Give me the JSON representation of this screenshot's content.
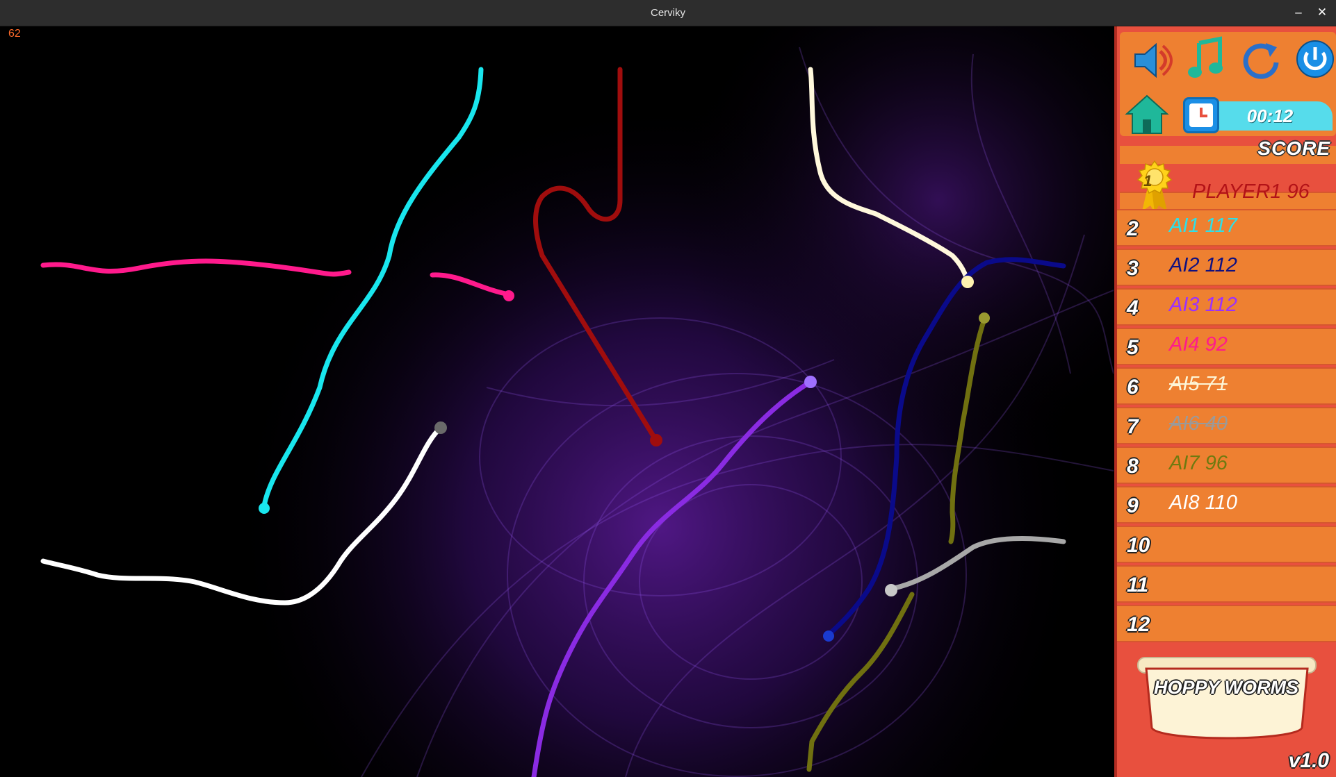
{
  "window": {
    "title": "Cerviky",
    "minimize_glyph": "–",
    "close_glyph": "✕"
  },
  "fps": "62",
  "toolbar": {
    "sound_icon": "speaker-icon",
    "music_icon": "music-note-icon",
    "restart_icon": "restart-icon",
    "power_icon": "power-icon",
    "home_icon": "home-icon",
    "clock_icon": "clock-icon",
    "timer": "00:12"
  },
  "score": {
    "label": "SCORE",
    "leader": {
      "rank": "1",
      "name": "PLAYER1 96",
      "color": "#b31217"
    },
    "rows": [
      {
        "rank": "2",
        "name": "AI1 117",
        "color": "#2de0e8",
        "strike": false
      },
      {
        "rank": "3",
        "name": "AI2 112",
        "color": "#101080",
        "strike": false
      },
      {
        "rank": "4",
        "name": "AI3 112",
        "color": "#9b30ff",
        "strike": false
      },
      {
        "rank": "5",
        "name": "AI4 92",
        "color": "#ff1a8c",
        "strike": false
      },
      {
        "rank": "6",
        "name": "AI5 71",
        "color": "#fdf6d8",
        "strike": true
      },
      {
        "rank": "7",
        "name": "AI6 40",
        "color": "#9a9a9a",
        "strike": true
      },
      {
        "rank": "8",
        "name": "AI7 96",
        "color": "#6f7a10",
        "strike": false
      },
      {
        "rank": "9",
        "name": "AI8 110",
        "color": "#ffffff",
        "strike": false
      },
      {
        "rank": "10",
        "name": "",
        "color": "#ffffff",
        "strike": false
      },
      {
        "rank": "11",
        "name": "",
        "color": "#ffffff",
        "strike": false
      },
      {
        "rank": "12",
        "name": "",
        "color": "#ffffff",
        "strike": false
      }
    ]
  },
  "logo": "HOPPY WORMS",
  "version": "v1.0",
  "worm_colors": {
    "player1": "#a00d0d",
    "ai1": "#19e6ee",
    "ai2": "#0a0a8a",
    "ai3": "#8a2be2",
    "ai4": "#ff1a8c",
    "ai5": "#fff8dc",
    "ai6": "#a8a8a8",
    "ai7": "#707010",
    "ai8": "#ffffff"
  }
}
